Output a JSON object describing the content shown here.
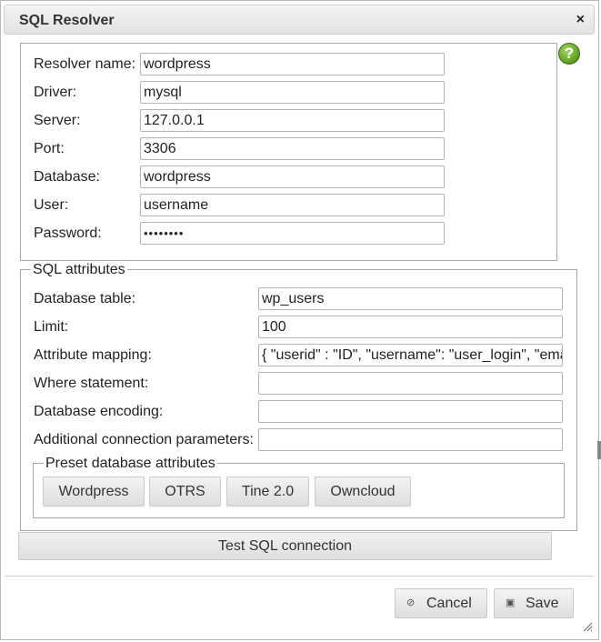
{
  "dialog": {
    "title": "SQL Resolver",
    "close_icon": "×",
    "help_icon": "?"
  },
  "resolver": {
    "name_label": "Resolver name:",
    "name_value": "wordpress",
    "driver_label": "Driver:",
    "driver_value": "mysql",
    "server_label": "Server:",
    "server_value": "127.0.0.1",
    "port_label": "Port:",
    "port_value": "3306",
    "database_label": "Database:",
    "database_value": "wordpress",
    "user_label": "User:",
    "user_value": "username",
    "password_label": "Password:",
    "password_value": "••••••••"
  },
  "sql_attributes": {
    "legend": "SQL attributes",
    "table_label": "Database table:",
    "table_value": "wp_users",
    "limit_label": "Limit:",
    "limit_value": "100",
    "mapping_label": "Attribute mapping:",
    "mapping_value": "{ \"userid\" : \"ID\", \"username\": \"user_login\", \"email\": \"user_email\" }",
    "where_label": "Where statement:",
    "where_value": "",
    "encoding_label": "Database encoding:",
    "encoding_value": "",
    "additional_label": "Additional connection parameters:",
    "additional_value": ""
  },
  "presets": {
    "legend": "Preset database attributes",
    "buttons": [
      "Wordpress",
      "OTRS",
      "Tine 2.0",
      "Owncloud"
    ]
  },
  "test_button": "Test SQL connection",
  "footer": {
    "cancel_icon": "⊘",
    "cancel_label": "Cancel",
    "save_icon": "▣",
    "save_label": "Save"
  }
}
